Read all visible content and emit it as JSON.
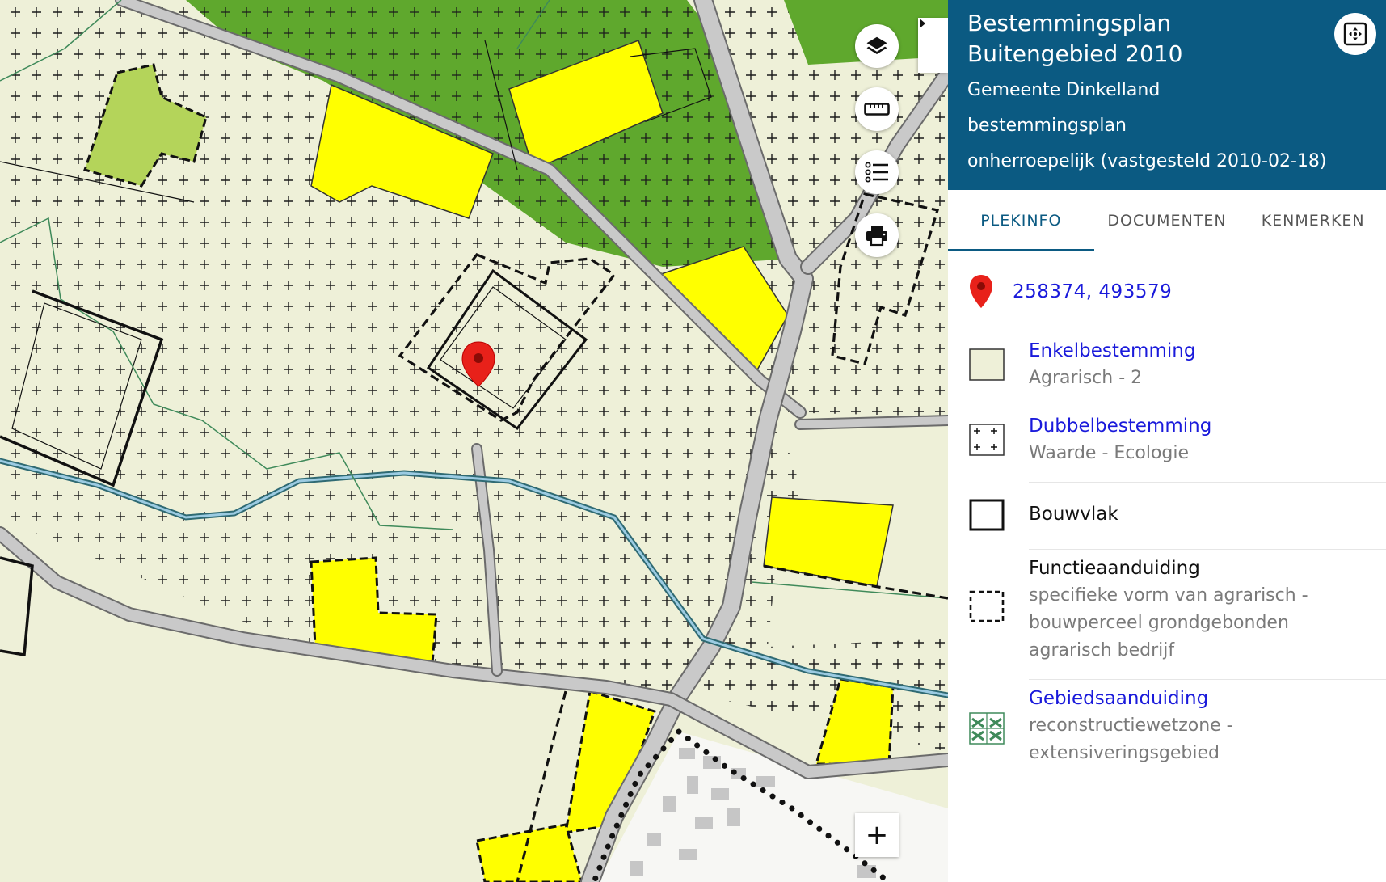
{
  "header": {
    "title": "Bestemmingsplan Buitengebied 2010",
    "municipality": "Gemeente Dinkelland",
    "plan_type": "bestemmingsplan",
    "status": "onherroepelijk (vastgesteld 2010-02-18)"
  },
  "tabs": [
    {
      "label": "PLEKINFO",
      "active": true
    },
    {
      "label": "DOCUMENTEN",
      "active": false
    },
    {
      "label": "KENMERKEN",
      "active": false
    }
  ],
  "location": {
    "coordinates": "258374, 493579",
    "icon": "location-pin-icon"
  },
  "legend": [
    {
      "title": "Enkelbestemming",
      "desc": "Agrarisch - 2",
      "link": true,
      "swatch": "enkelbestemming-swatch"
    },
    {
      "title": "Dubbelbestemming",
      "desc": "Waarde - Ecologie",
      "link": true,
      "swatch": "dubbelbestemming-swatch"
    },
    {
      "title": "Bouwvlak",
      "desc": "",
      "link": false,
      "swatch": "bouwvlak-swatch"
    },
    {
      "title": "Functieaanduiding",
      "desc": "specifieke vorm van agrarisch - bouwperceel grondgebonden agrarisch bedrijf",
      "link": false,
      "swatch": "functieaanduiding-swatch"
    },
    {
      "title": "Gebiedsaanduiding",
      "desc": "reconstructiewetzone - extensiveringsgebied",
      "link": true,
      "swatch": "gebiedsaanduiding-swatch"
    }
  ],
  "map_controls": {
    "layers": "layers-icon",
    "measure": "ruler-icon",
    "legend": "list-icon",
    "print": "printer-icon",
    "zoom_in": "+"
  },
  "colors": {
    "header_bg": "#0b5a82",
    "link": "#1a1adb",
    "agrarisch": "#eef0d8",
    "wonen": "#ffff00",
    "bos": "#5fa82d",
    "natuur": "#b4d45a",
    "pin": "#e8211a"
  }
}
